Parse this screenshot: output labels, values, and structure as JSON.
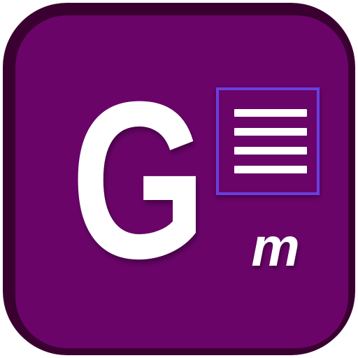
{
  "app_icon": {
    "letter": "G",
    "sub_letter": "m",
    "icon_document": "document-lines-icon",
    "colors": {
      "frame": "#3a0030",
      "background": "#6a0469",
      "document_border": "#6a3fe0",
      "foreground": "#ffffff"
    }
  }
}
